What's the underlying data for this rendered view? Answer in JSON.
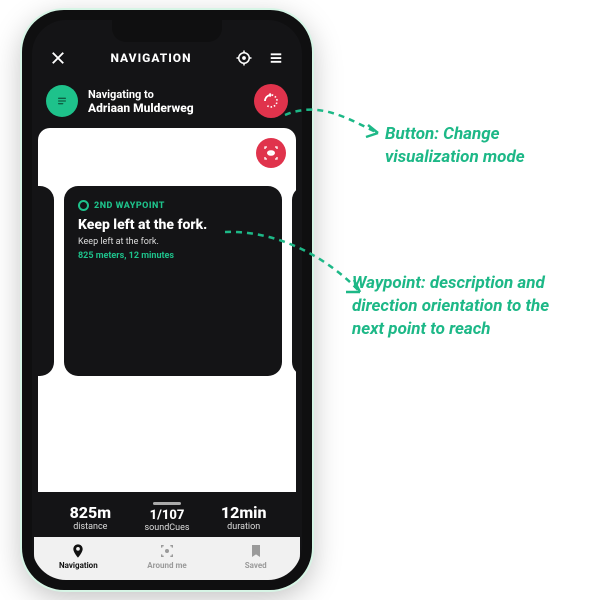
{
  "header": {
    "title": "NAVIGATION"
  },
  "destination": {
    "label": "Navigating to",
    "name": "Adriaan Mulderweg"
  },
  "waypoint": {
    "label": "2ND WAYPOINT",
    "instruction": "Keep left at the fork.",
    "description": "Keep left at the fork.",
    "meta": "825 meters, 12 minutes"
  },
  "stats": {
    "distance_value": "825m",
    "distance_label": "distance",
    "cues_value": "1/107",
    "cues_label": "soundCues",
    "duration_value": "12min",
    "duration_label": "duration"
  },
  "tabs": {
    "navigation": "Navigation",
    "around": "Around me",
    "saved": "Saved"
  },
  "annotations": {
    "change_mode": "Button: Change visualization mode",
    "waypoint_desc": "Waypoint: description and direction orientation to the next point to reach"
  },
  "colors": {
    "accent": "#1EC28B",
    "danger": "#E0334C"
  }
}
